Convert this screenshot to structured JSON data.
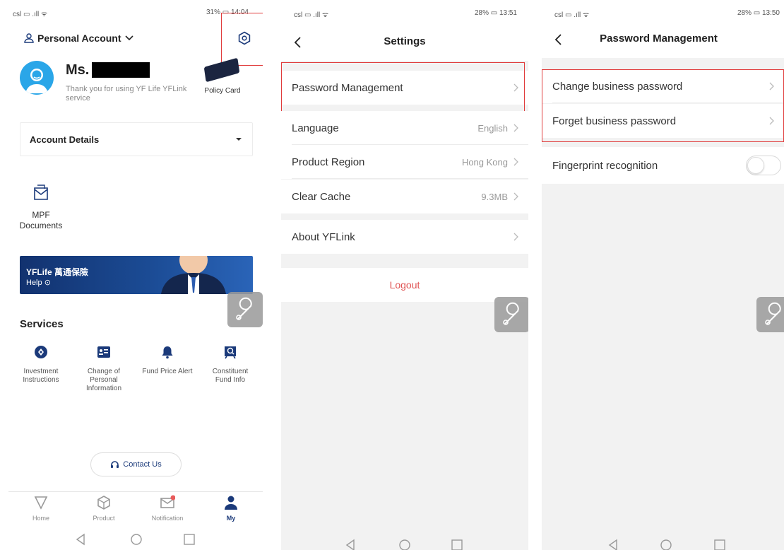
{
  "screen1": {
    "status": {
      "left": "csl ▭ .ıll ᯤ",
      "right": "31% ▭ 14:04"
    },
    "account_switch": "Personal Account",
    "user": {
      "name_prefix": "Ms.",
      "message": "Thank you for using YF Life YFLink service"
    },
    "policy_card_label": "Policy Card",
    "account_details_label": "Account Details",
    "mpf_documents_label": "MPF Documents",
    "banner": {
      "brand": "YFLife 萬通保險",
      "help": "Help"
    },
    "services_title": "Services",
    "services": [
      {
        "label": "Investment Instructions",
        "icon": "investment-icon"
      },
      {
        "label": "Change of Personal Information",
        "icon": "personal-info-icon"
      },
      {
        "label": "Fund Price Alert",
        "icon": "bell-icon"
      },
      {
        "label": "Constituent Fund Info",
        "icon": "fund-info-icon"
      }
    ],
    "contact_us": "Contact Us",
    "tabs": [
      {
        "label": "Home",
        "icon": "home-icon"
      },
      {
        "label": "Product",
        "icon": "product-icon"
      },
      {
        "label": "Notification",
        "icon": "notification-icon"
      },
      {
        "label": "My",
        "icon": "user-icon",
        "active": true
      }
    ],
    "accent_color": "#1b3a7a",
    "highlight_color": "#e03b3b"
  },
  "screen2": {
    "status": {
      "left": "csl ▭ .ıll ᯤ",
      "right": "28% ▭ 13:51"
    },
    "title": "Settings",
    "rows": [
      {
        "label": "Password Management",
        "value": ""
      },
      {
        "label": "Language",
        "value": "English"
      },
      {
        "label": "Product Region",
        "value": "Hong Kong"
      },
      {
        "label": "Clear Cache",
        "value": "9.3MB"
      },
      {
        "label": "About YFLink",
        "value": ""
      }
    ],
    "logout": "Logout"
  },
  "screen3": {
    "status": {
      "left": "csl ▭ .ıll ᯤ",
      "right": "28% ▭ 13:50"
    },
    "title": "Password Management",
    "rows": [
      {
        "label": "Change business password"
      },
      {
        "label": "Forget business password"
      }
    ],
    "fingerprint_label": "Fingerprint recognition",
    "fingerprint_enabled": false
  }
}
